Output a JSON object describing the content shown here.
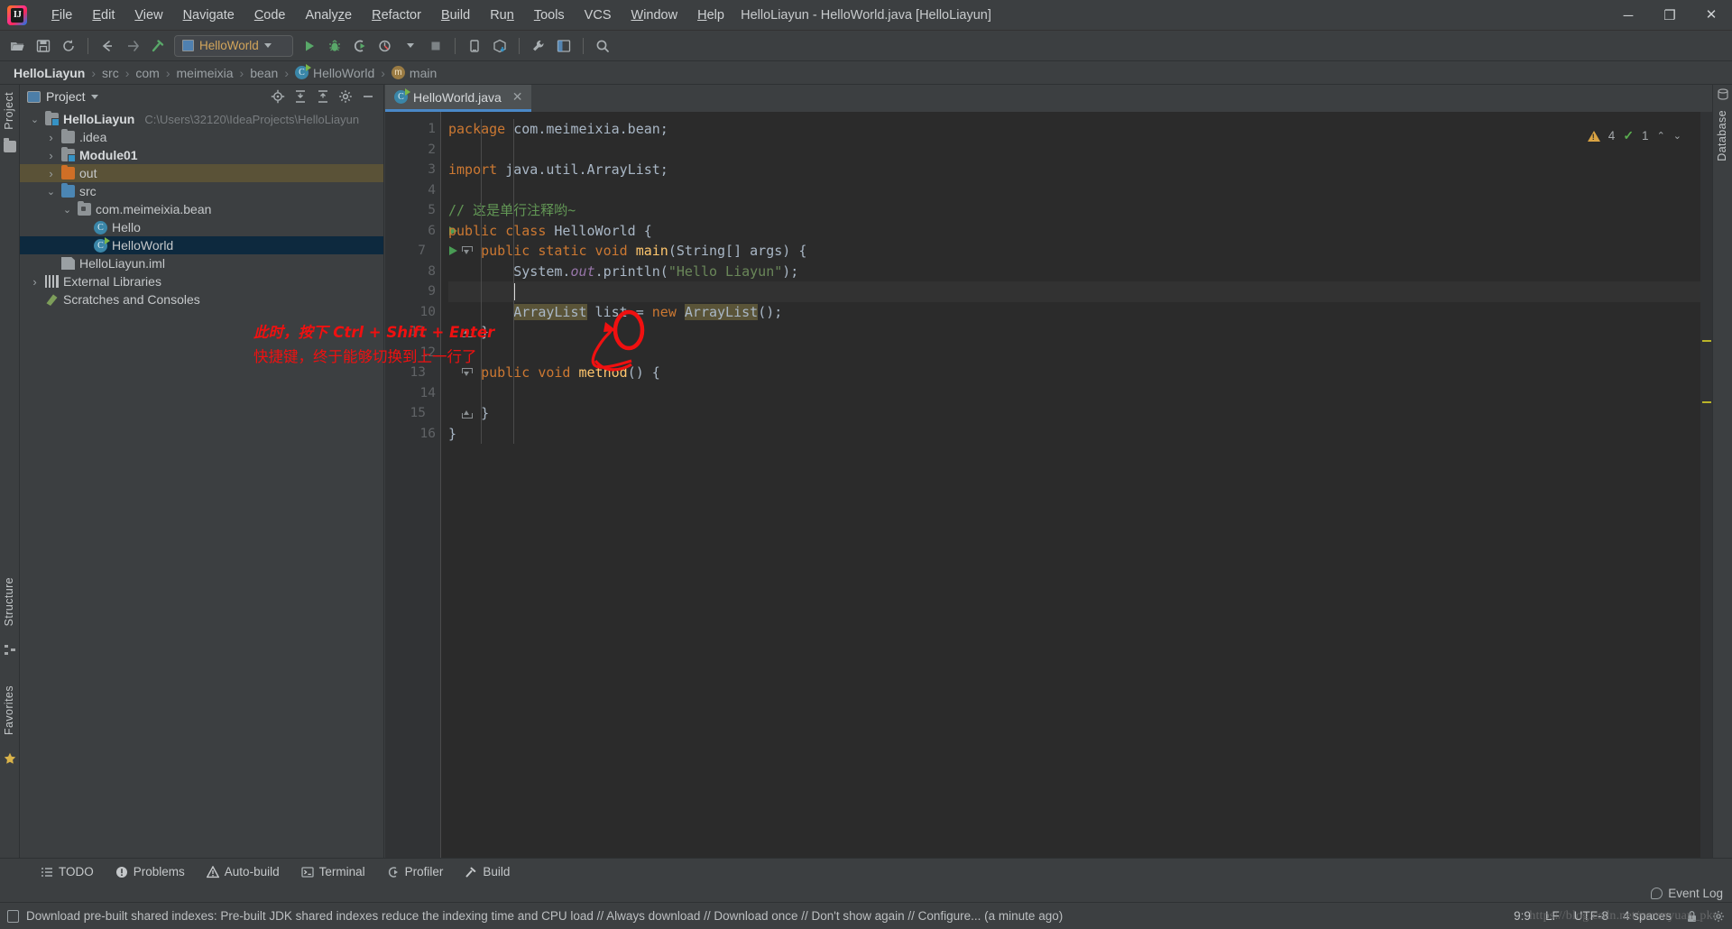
{
  "window": {
    "title": "HelloLiayun - HelloWorld.java [HelloLiayun]",
    "minimize": "─",
    "maximize": "❐",
    "close": "✕"
  },
  "menubar": {
    "items": [
      {
        "label": "File"
      },
      {
        "label": "Edit"
      },
      {
        "label": "View"
      },
      {
        "label": "Navigate"
      },
      {
        "label": "Code"
      },
      {
        "label": "Analyze"
      },
      {
        "label": "Refactor"
      },
      {
        "label": "Build"
      },
      {
        "label": "Run"
      },
      {
        "label": "Tools"
      },
      {
        "label": "VCS"
      },
      {
        "label": "Window"
      },
      {
        "label": "Help"
      }
    ]
  },
  "toolbar": {
    "run_configuration": "HelloWorld",
    "icons": [
      "open-folder-icon",
      "save-all-icon",
      "sync-icon",
      "back-icon",
      "forward-icon",
      "build-hammer-icon",
      "run-icon",
      "debug-icon",
      "run-coverage-icon",
      "profile-icon",
      "stop-icon",
      "device-manager-icon",
      "sdk-manager-icon",
      "settings-wrench-icon",
      "project-structure-icon",
      "search-everywhere-icon"
    ]
  },
  "breadcrumb": {
    "items": [
      {
        "label": "HelloLiayun",
        "strong": true,
        "icon": ""
      },
      {
        "label": "src",
        "strong": false,
        "icon": ""
      },
      {
        "label": "com",
        "strong": false,
        "icon": ""
      },
      {
        "label": "meimeixia",
        "strong": false,
        "icon": ""
      },
      {
        "label": "bean",
        "strong": false,
        "icon": ""
      },
      {
        "label": "HelloWorld",
        "strong": false,
        "icon": "class-icon"
      },
      {
        "label": "main",
        "strong": false,
        "icon": "method-icon"
      }
    ],
    "separator": "›"
  },
  "left_rail": {
    "project_label": "Project",
    "structure_label": "Structure",
    "favorites_label": "Favorites"
  },
  "right_rail": {
    "database_label": "Database"
  },
  "project_panel": {
    "title": "Project",
    "actions": [
      "locate-icon",
      "expand-all-icon",
      "collapse-all-icon",
      "settings-gear-icon",
      "hide-icon"
    ],
    "tree": [
      {
        "label": "HelloLiayun",
        "path": "C:\\Users\\32120\\IdeaProjects\\HelloLiayun",
        "depth": 0,
        "arrow": "down",
        "icon": "module-folder-icon",
        "bold": true,
        "state": "none"
      },
      {
        "label": ".idea",
        "path": "",
        "depth": 1,
        "arrow": "right",
        "icon": "folder-icon",
        "bold": false,
        "state": "none"
      },
      {
        "label": "Module01",
        "path": "",
        "depth": 1,
        "arrow": "right",
        "icon": "module-folder-icon",
        "bold": true,
        "state": "none"
      },
      {
        "label": "out",
        "path": "",
        "depth": 1,
        "arrow": "right",
        "icon": "folder-orange-icon",
        "bold": false,
        "state": "highlight"
      },
      {
        "label": "src",
        "path": "",
        "depth": 1,
        "arrow": "down",
        "icon": "folder-blue-icon",
        "bold": false,
        "state": "none"
      },
      {
        "label": "com.meimeixia.bean",
        "path": "",
        "depth": 2,
        "arrow": "down",
        "icon": "package-icon",
        "bold": false,
        "state": "none"
      },
      {
        "label": "Hello",
        "path": "",
        "depth": 3,
        "arrow": "none",
        "icon": "class-icon",
        "bold": false,
        "state": "none"
      },
      {
        "label": "HelloWorld",
        "path": "",
        "depth": 3,
        "arrow": "none",
        "icon": "class-runnable-icon",
        "bold": false,
        "state": "selected"
      },
      {
        "label": "HelloLiayun.iml",
        "path": "",
        "depth": 1,
        "arrow": "none",
        "icon": "iml-icon",
        "bold": false,
        "state": "none"
      },
      {
        "label": "External Libraries",
        "path": "",
        "depth": 0,
        "arrow": "right",
        "icon": "libraries-icon",
        "bold": false,
        "state": "none"
      },
      {
        "label": "Scratches and Consoles",
        "path": "",
        "depth": 0,
        "arrow": "none",
        "icon": "scratches-icon",
        "bold": false,
        "state": "none"
      }
    ]
  },
  "editor": {
    "tab": {
      "label": "HelloWorld.java",
      "icon": "java-class-runnable-icon",
      "close": "✕"
    },
    "inspection": {
      "warning_count": "4",
      "weak_warning_count": "1",
      "up": "⌃",
      "down": "⌄"
    },
    "lines": [
      {
        "n": "1",
        "run": false,
        "fold": "",
        "tokens": [
          {
            "t": "package ",
            "c": "kw"
          },
          {
            "t": "com.meimeixia.bean;",
            "c": "txt"
          }
        ]
      },
      {
        "n": "2",
        "run": false,
        "fold": "",
        "tokens": []
      },
      {
        "n": "3",
        "run": false,
        "fold": "",
        "tokens": [
          {
            "t": "import ",
            "c": "kw"
          },
          {
            "t": "java.util.ArrayList;",
            "c": "txt"
          }
        ]
      },
      {
        "n": "4",
        "run": false,
        "fold": "",
        "tokens": []
      },
      {
        "n": "5",
        "run": false,
        "fold": "",
        "tokens": [
          {
            "t": "// 这是单行注释哟~",
            "c": "cmt"
          }
        ]
      },
      {
        "n": "6",
        "run": true,
        "fold": "",
        "tokens": [
          {
            "t": "public class ",
            "c": "kw"
          },
          {
            "t": "HelloWorld {",
            "c": "txt"
          }
        ]
      },
      {
        "n": "7",
        "run": true,
        "fold": "minus",
        "tokens": [
          {
            "t": "    ",
            "c": "txt"
          },
          {
            "t": "public static void ",
            "c": "kw"
          },
          {
            "t": "main",
            "c": "mth"
          },
          {
            "t": "(String[] args) {",
            "c": "txt"
          }
        ]
      },
      {
        "n": "8",
        "run": false,
        "fold": "",
        "tokens": [
          {
            "t": "        System.",
            "c": "txt"
          },
          {
            "t": "out",
            "c": "fld"
          },
          {
            "t": ".println(",
            "c": "txt"
          },
          {
            "t": "\"Hello Liayun\"",
            "c": "st"
          },
          {
            "t": ");",
            "c": "txt"
          }
        ]
      },
      {
        "n": "9",
        "run": false,
        "fold": "",
        "tokens": [
          {
            "t": "        ",
            "c": "txt"
          }
        ],
        "current": true
      },
      {
        "n": "10",
        "run": false,
        "fold": "",
        "tokens": [
          {
            "t": "        ",
            "c": "txt"
          },
          {
            "t": "ArrayList",
            "c": "hl"
          },
          {
            "t": " list = ",
            "c": "txt"
          },
          {
            "t": "new ",
            "c": "kw"
          },
          {
            "t": "ArrayList",
            "c": "hl"
          },
          {
            "t": "();",
            "c": "txt"
          }
        ]
      },
      {
        "n": "11",
        "run": false,
        "fold": "end",
        "tokens": [
          {
            "t": "    }",
            "c": "txt"
          }
        ]
      },
      {
        "n": "12",
        "run": false,
        "fold": "",
        "tokens": []
      },
      {
        "n": "13",
        "run": false,
        "fold": "minus",
        "tokens": [
          {
            "t": "    ",
            "c": "txt"
          },
          {
            "t": "public void ",
            "c": "kw"
          },
          {
            "t": "method",
            "c": "mth"
          },
          {
            "t": "() {",
            "c": "txt"
          }
        ]
      },
      {
        "n": "14",
        "run": false,
        "fold": "",
        "tokens": []
      },
      {
        "n": "15",
        "run": false,
        "fold": "end",
        "tokens": [
          {
            "t": "    }",
            "c": "txt"
          }
        ]
      },
      {
        "n": "16",
        "run": false,
        "fold": "",
        "tokens": [
          {
            "t": "}",
            "c": "txt"
          }
        ]
      }
    ]
  },
  "annotations": {
    "line1": "此时，按下 Ctrl + Shift + Enter",
    "line2": "快捷键，终于能够切换到上一行了",
    "color": "#f01010"
  },
  "bottom_tools": [
    {
      "label": "TODO",
      "icon": "todo-list-icon"
    },
    {
      "label": "Problems",
      "icon": "problems-icon"
    },
    {
      "label": "Auto-build",
      "icon": "auto-build-icon"
    },
    {
      "label": "Terminal",
      "icon": "terminal-icon"
    },
    {
      "label": "Profiler",
      "icon": "profiler-icon"
    },
    {
      "label": "Build",
      "icon": "build-hammer-icon"
    }
  ],
  "status_bar": {
    "notification": "Download pre-built shared indexes: Pre-built JDK shared indexes reduce the indexing time and CPU load // Always download // Download once // Don't show again // Configure... (a minute ago)",
    "event_log": "Event Log",
    "caret_position": "9:9",
    "line_separator": "LF",
    "encoding": "UTF-8",
    "indent": "4 spaces",
    "lock_icon": "read-only-lock-icon",
    "gear_icon": "settings-gear-icon"
  },
  "watermark": "https://blog.csdn.net/yerenyuan_pku"
}
